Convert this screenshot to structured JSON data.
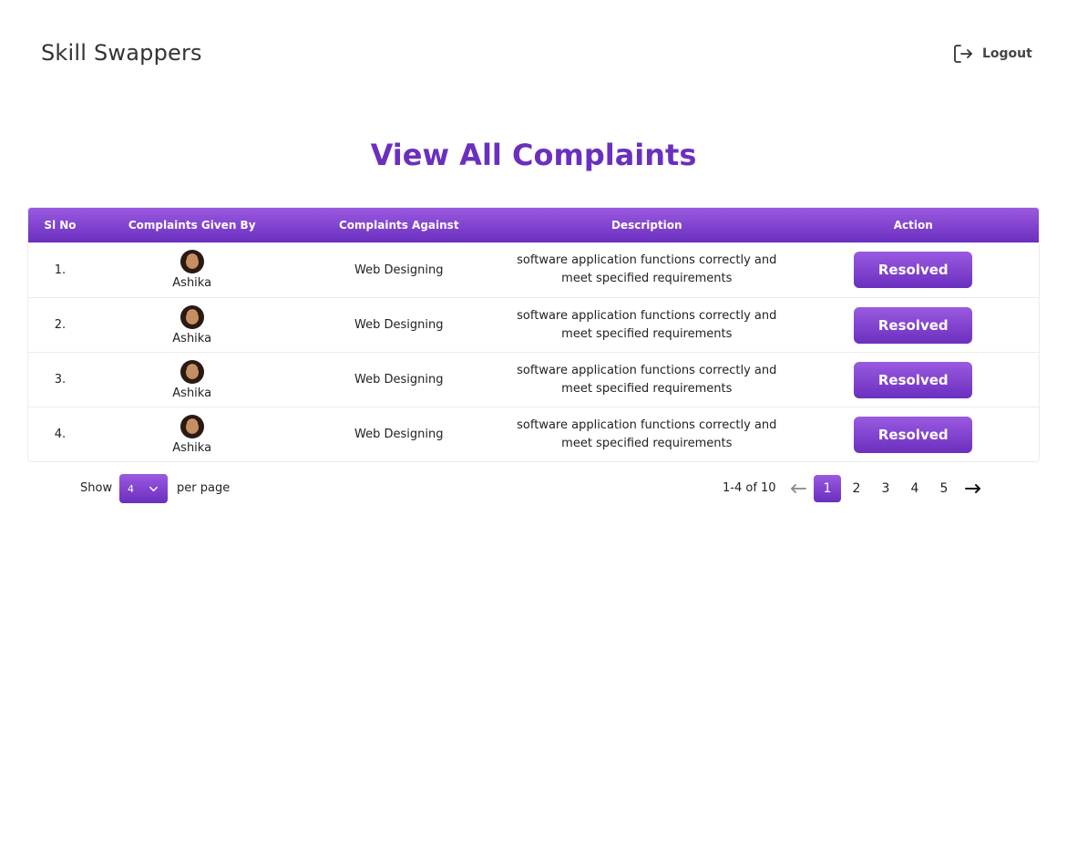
{
  "app": {
    "brand": "Skill Swappers"
  },
  "header": {
    "logout_label": "Logout"
  },
  "page": {
    "title": "View All Complaints"
  },
  "table": {
    "columns": [
      "Sl No",
      "Complaints Given By",
      "Complaints Against",
      "Description",
      "Action"
    ],
    "rows": [
      {
        "sl": "1.",
        "by": "Ashika",
        "against": "Web Designing",
        "description": "software application functions correctly and meet specified requirements",
        "action": "Resolved"
      },
      {
        "sl": "2.",
        "by": "Ashika",
        "against": "Web Designing",
        "description": "software application functions correctly and meet specified requirements",
        "action": "Resolved"
      },
      {
        "sl": "3.",
        "by": "Ashika",
        "against": "Web Designing",
        "description": "software application functions correctly and meet specified requirements",
        "action": "Resolved"
      },
      {
        "sl": "4.",
        "by": "Ashika",
        "against": "Web Designing",
        "description": "software application functions correctly and meet specified requirements",
        "action": "Resolved"
      }
    ]
  },
  "pagination": {
    "show_label": "Show",
    "per_page_value": "4",
    "per_page_label": "per page",
    "range": "1-4 of 10",
    "pages": [
      "1",
      "2",
      "3",
      "4",
      "5"
    ],
    "current_page": "1"
  },
  "colors": {
    "accent": "#6b2fbf",
    "accent_light": "#9a5ae0"
  },
  "icons": {
    "logout": "logout-icon",
    "prev": "arrow-left-icon",
    "next": "arrow-right-icon",
    "select": "chevron-down-icon"
  }
}
